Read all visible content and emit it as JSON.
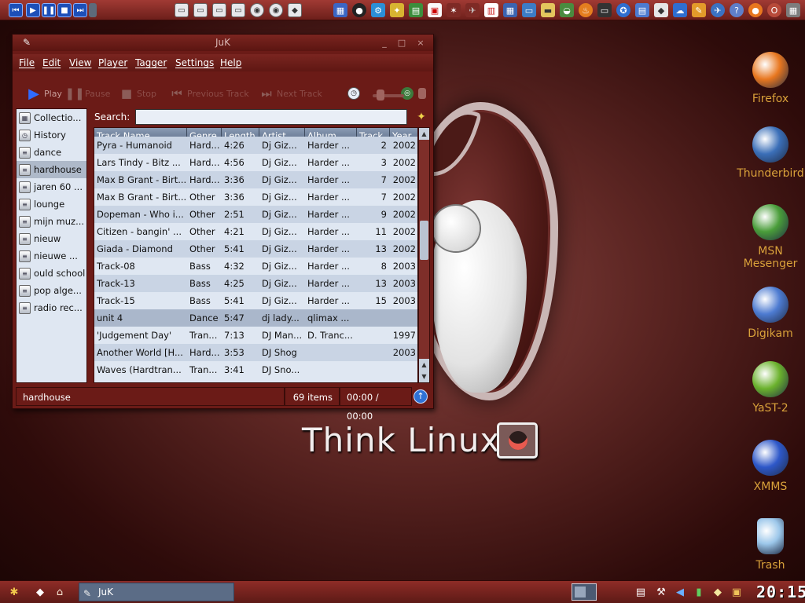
{
  "window": {
    "title": "JuK",
    "buttons": {
      "minimize": "_",
      "maximize": "□",
      "close": "×"
    }
  },
  "menu": [
    "File",
    "Edit",
    "View",
    "Player",
    "Tagger",
    "Settings",
    "Help"
  ],
  "toolbar": {
    "play": "Play",
    "pause": "Pause",
    "stop": "Stop",
    "previous": "Previous Track",
    "next": "Next Track"
  },
  "sidebar": {
    "items": [
      {
        "label": "Collectio...",
        "icon": "collection-icon"
      },
      {
        "label": "History",
        "icon": "clock-icon"
      },
      {
        "label": "dance",
        "icon": "playlist-icon"
      },
      {
        "label": "hardhouse",
        "icon": "playlist-icon",
        "selected": true
      },
      {
        "label": "jaren 60 ...",
        "icon": "playlist-icon"
      },
      {
        "label": "lounge",
        "icon": "playlist-icon"
      },
      {
        "label": "mijn muz...",
        "icon": "playlist-icon"
      },
      {
        "label": "nieuw",
        "icon": "playlist-icon"
      },
      {
        "label": "nieuwe ...",
        "icon": "playlist-icon"
      },
      {
        "label": "ould school",
        "icon": "playlist-icon"
      },
      {
        "label": "pop alge...",
        "icon": "playlist-icon"
      },
      {
        "label": "radio rec...",
        "icon": "playlist-icon"
      }
    ]
  },
  "search": {
    "label": "Search:",
    "value": "",
    "placeholder": ""
  },
  "table": {
    "columns": [
      "Track Name",
      "Genre",
      "Length",
      "Artist",
      "Album",
      "Track",
      "Year"
    ],
    "rows": [
      [
        "Pyra - Humanoid",
        "Hard...",
        "4:26",
        "Dj Giz...",
        "Harder ...",
        "2",
        "2002"
      ],
      [
        "Lars Tindy - Bitz ...",
        "Hard...",
        "4:56",
        "Dj Giz...",
        "Harder ...",
        "3",
        "2002"
      ],
      [
        "Max B Grant - Birt...",
        "Hard...",
        "3:36",
        "Dj Giz...",
        "Harder ...",
        "7",
        "2002"
      ],
      [
        "Max B Grant - Birt...",
        "Other",
        "3:36",
        "Dj Giz...",
        "Harder ...",
        "7",
        "2002"
      ],
      [
        "Dopeman - Who i...",
        "Other",
        "2:51",
        "Dj Giz...",
        "Harder ...",
        "9",
        "2002"
      ],
      [
        "Citizen - bangin' ...",
        "Other",
        "4:21",
        "Dj Giz...",
        "Harder ...",
        "11",
        "2002"
      ],
      [
        "Giada - Diamond",
        "Other",
        "5:41",
        "Dj Giz...",
        "Harder ...",
        "13",
        "2002"
      ],
      [
        "Track-08",
        "Bass",
        "4:32",
        "Dj Giz...",
        "Harder ...",
        "8",
        "2003"
      ],
      [
        "Track-13",
        "Bass",
        "4:25",
        "Dj Giz...",
        "Harder ...",
        "13",
        "2003"
      ],
      [
        "Track-15",
        "Bass",
        "5:41",
        "Dj Giz...",
        "Harder ...",
        "15",
        "2003"
      ],
      [
        "unit 4",
        "Dance",
        "5:47",
        "dj lady...",
        "qlimax ...",
        "",
        ""
      ],
      [
        "'Judgement Day'",
        "Tran...",
        "7:13",
        "DJ Man...",
        "D. Tranc...",
        "",
        "1997"
      ],
      [
        "Another World [H...",
        "Hard...",
        "3:53",
        "DJ Shog",
        "",
        "",
        "2003"
      ],
      [
        "Waves (Hardtran...",
        "Tran...",
        "3:41",
        "DJ Sno...",
        "",
        "",
        ""
      ]
    ],
    "selected_row": 10
  },
  "status": {
    "playlist": "hardhouse",
    "count": "69 items",
    "time": "00:00 / 00:00"
  },
  "desktop": {
    "icons": [
      {
        "label": "Firefox",
        "icon": "firefox-icon",
        "color": "#e8771f"
      },
      {
        "label": "Thunderbird",
        "icon": "thunderbird-icon",
        "color": "#3b6fb8"
      },
      {
        "label": "MSN Mesenger",
        "icon": "msn-icon",
        "color": "#4a9d3a"
      },
      {
        "label": "Digikam",
        "icon": "digikam-icon",
        "color": "#4d7bd1"
      },
      {
        "label": "YaST-2",
        "icon": "yast-icon",
        "color": "#6bb22d"
      },
      {
        "label": "XMMS",
        "icon": "xmms-icon",
        "color": "#2e58c9"
      },
      {
        "label": "Trash",
        "icon": "trash-icon",
        "color": "#9cc7ea"
      }
    ],
    "wallpaper_text": "Think Linux"
  },
  "taskbar": {
    "task": "JuK",
    "clock": "20:15"
  },
  "colors": {
    "accent": "#6b1b17",
    "selection": "#aab7cb",
    "desktop_label": "#d9a13a"
  }
}
